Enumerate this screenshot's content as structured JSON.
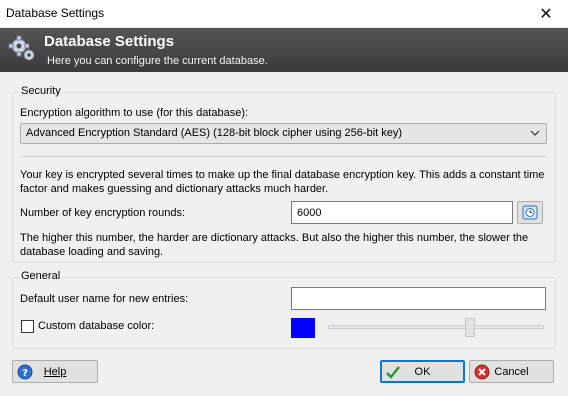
{
  "window": {
    "title": "Database Settings",
    "close_glyph": "✕"
  },
  "banner": {
    "title": "Database Settings",
    "subtitle": "Here you can configure the current database.",
    "icon": "gear-icon"
  },
  "security": {
    "legend": "Security",
    "algorithm_label": "Encryption algorithm to use (for this database):",
    "algorithm_value": "Advanced Encryption Standard (AES) (128-bit block cipher using 256-bit key)",
    "info_text": "Your key is encrypted several times to make up the final database encryption key. This adds a constant time factor and makes guessing and dictionary attacks much harder.",
    "rounds_label": "Number of key encryption rounds:",
    "rounds_value": "6000",
    "rounds_note": "The higher this number, the harder are dictionary attacks. But also the higher this number, the slower the database loading and saving."
  },
  "general": {
    "legend": "General",
    "username_label": "Default user name for new entries:",
    "username_value": "",
    "custom_color_label": "Custom database color:",
    "custom_color_checked": false,
    "color": "#0000ff"
  },
  "buttons": {
    "help": "Help",
    "ok": "OK",
    "cancel": "Cancel"
  }
}
